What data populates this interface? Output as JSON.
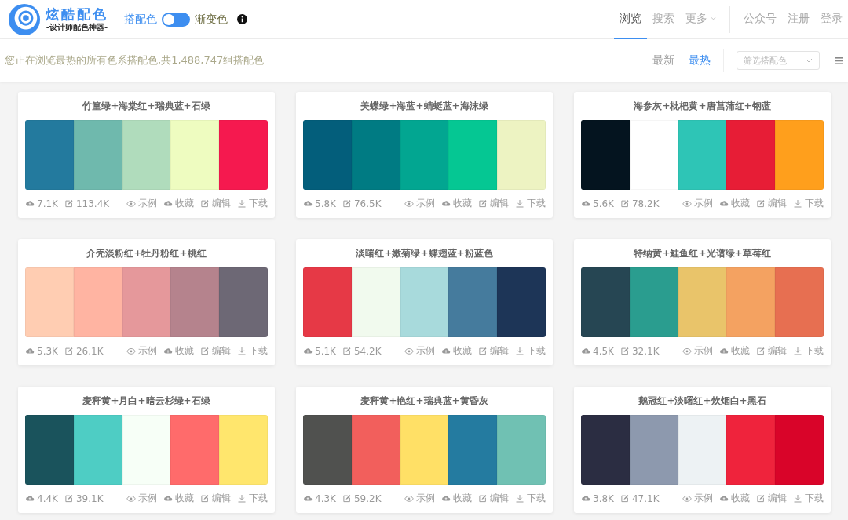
{
  "logo": {
    "title": "炫酷配色",
    "subtitle": "-设计师配色神器-"
  },
  "mode_switch": {
    "left_label": "搭配色",
    "right_label": "渐变色",
    "on": false
  },
  "nav": [
    {
      "label": "浏览",
      "selected": true
    },
    {
      "label": "搜索",
      "selected": false
    },
    {
      "label": "更多",
      "selected": false,
      "kind": "dropdown"
    },
    {
      "label": "公众号",
      "selected": false,
      "kind": "divided"
    },
    {
      "label": "注册",
      "selected": false
    },
    {
      "label": "登录",
      "selected": false
    }
  ],
  "summary": "您正在浏览最热的所有色系搭配色,共1,488,747组搭配色",
  "sort": [
    {
      "label": "最新",
      "selected": false
    },
    {
      "label": "最热",
      "selected": true
    }
  ],
  "filter": {
    "placeholder": "筛选搭配色"
  },
  "cards": [
    {
      "title": "竹篁绿+海棠红+瑞典蓝+石绿",
      "swatches": [
        {
          "color": "#237a9e"
        },
        {
          "color": "#6fb9ad"
        },
        {
          "color": "#b0dcbc"
        },
        {
          "color": "#eefcc0"
        },
        {
          "color": "#f5194f"
        }
      ],
      "stats": [
        {
          "kind": "cloud",
          "value": "7.1K"
        },
        {
          "kind": "edit",
          "value": "113.4K"
        }
      ],
      "actions": [
        {
          "kind": "eye",
          "label": "示例"
        },
        {
          "kind": "cloud",
          "label": "收藏"
        },
        {
          "kind": "edit",
          "label": "编辑"
        },
        {
          "kind": "download",
          "label": "下载"
        }
      ]
    },
    {
      "title": "美蝶绿+海蓝+蜻蜓蓝+海沫绿",
      "swatches": [
        {
          "color": "#035e7b"
        },
        {
          "color": "#007b83"
        },
        {
          "color": "#02a691"
        },
        {
          "color": "#05c793"
        },
        {
          "color": "#edf3c2"
        }
      ],
      "stats": [
        {
          "kind": "cloud",
          "value": "5.8K"
        },
        {
          "kind": "edit",
          "value": "76.5K"
        }
      ],
      "actions": [
        {
          "kind": "eye",
          "label": "示例"
        },
        {
          "kind": "cloud",
          "label": "收藏"
        },
        {
          "kind": "edit",
          "label": "编辑"
        },
        {
          "kind": "download",
          "label": "下载"
        }
      ]
    },
    {
      "title": "海参灰+枇杷黄+唐菖蒲红+钢蓝",
      "swatches": [
        {
          "color": "#04141f"
        },
        {
          "color": "#ffffff"
        },
        {
          "color": "#2ec5b6"
        },
        {
          "color": "#e71d36"
        },
        {
          "color": "#ff9f1c"
        }
      ],
      "stats": [
        {
          "kind": "cloud",
          "value": "5.6K"
        },
        {
          "kind": "edit",
          "value": "78.2K"
        }
      ],
      "actions": [
        {
          "kind": "eye",
          "label": "示例"
        },
        {
          "kind": "cloud",
          "label": "收藏"
        },
        {
          "kind": "edit",
          "label": "编辑"
        },
        {
          "kind": "download",
          "label": "下载"
        }
      ]
    },
    {
      "title": "介壳淡粉红+牡丹粉红+桃红",
      "swatches": [
        {
          "color": "#ffcdb2"
        },
        {
          "color": "#ffb4a2"
        },
        {
          "color": "#e5989b"
        },
        {
          "color": "#b5838d"
        },
        {
          "color": "#6d6875"
        }
      ],
      "stats": [
        {
          "kind": "cloud",
          "value": "5.3K"
        },
        {
          "kind": "edit",
          "value": "26.1K"
        }
      ],
      "actions": [
        {
          "kind": "eye",
          "label": "示例"
        },
        {
          "kind": "cloud",
          "label": "收藏"
        },
        {
          "kind": "edit",
          "label": "编辑"
        },
        {
          "kind": "download",
          "label": "下载"
        }
      ]
    },
    {
      "title": "淡曙红+嫩菊绿+蝶翅蓝+粉蓝色",
      "swatches": [
        {
          "color": "#e63946"
        },
        {
          "color": "#f1faee"
        },
        {
          "color": "#a8dadc"
        },
        {
          "color": "#457b9d"
        },
        {
          "color": "#1d3557"
        }
      ],
      "stats": [
        {
          "kind": "cloud",
          "value": "5.1K"
        },
        {
          "kind": "edit",
          "value": "54.2K"
        }
      ],
      "actions": [
        {
          "kind": "eye",
          "label": "示例"
        },
        {
          "kind": "cloud",
          "label": "收藏"
        },
        {
          "kind": "edit",
          "label": "编辑"
        },
        {
          "kind": "download",
          "label": "下载"
        }
      ]
    },
    {
      "title": "特纳黄+鲑鱼红+光谱绿+草莓红",
      "swatches": [
        {
          "color": "#264653"
        },
        {
          "color": "#2a9d8f"
        },
        {
          "color": "#e9c46a"
        },
        {
          "color": "#f4a261"
        },
        {
          "color": "#e76f51"
        }
      ],
      "stats": [
        {
          "kind": "cloud",
          "value": "4.5K"
        },
        {
          "kind": "edit",
          "value": "32.1K"
        }
      ],
      "actions": [
        {
          "kind": "eye",
          "label": "示例"
        },
        {
          "kind": "cloud",
          "label": "收藏"
        },
        {
          "kind": "edit",
          "label": "编辑"
        },
        {
          "kind": "download",
          "label": "下载"
        }
      ]
    },
    {
      "title": "麦秆黄+月白+暗云杉绿+石绿",
      "swatches": [
        {
          "color": "#1a535c"
        },
        {
          "color": "#4ecdc4"
        },
        {
          "color": "#f7fff7"
        },
        {
          "color": "#ff6b6b"
        },
        {
          "color": "#ffe66d"
        }
      ],
      "stats": [
        {
          "kind": "cloud",
          "value": "4.4K"
        },
        {
          "kind": "edit",
          "value": "39.1K"
        }
      ],
      "actions": [
        {
          "kind": "eye",
          "label": "示例"
        },
        {
          "kind": "cloud",
          "label": "收藏"
        },
        {
          "kind": "edit",
          "label": "编辑"
        },
        {
          "kind": "download",
          "label": "下载"
        }
      ]
    },
    {
      "title": "麦秆黄+艳红+瑞典蓝+黄昏灰",
      "swatches": [
        {
          "color": "#50514f"
        },
        {
          "color": "#f25f5c"
        },
        {
          "color": "#ffe066"
        },
        {
          "color": "#247ba0"
        },
        {
          "color": "#70c1b3"
        }
      ],
      "stats": [
        {
          "kind": "cloud",
          "value": "4.3K"
        },
        {
          "kind": "edit",
          "value": "59.2K"
        }
      ],
      "actions": [
        {
          "kind": "eye",
          "label": "示例"
        },
        {
          "kind": "cloud",
          "label": "收藏"
        },
        {
          "kind": "edit",
          "label": "编辑"
        },
        {
          "kind": "download",
          "label": "下载"
        }
      ]
    },
    {
      "title": "鹅冠红+淡曙红+炊烟白+黑石",
      "swatches": [
        {
          "color": "#2b2d42"
        },
        {
          "color": "#8d99ae"
        },
        {
          "color": "#edf2f4"
        },
        {
          "color": "#ef233c"
        },
        {
          "color": "#d90429"
        }
      ],
      "stats": [
        {
          "kind": "cloud",
          "value": "3.8K"
        },
        {
          "kind": "edit",
          "value": "47.1K"
        }
      ],
      "actions": [
        {
          "kind": "eye",
          "label": "示例"
        },
        {
          "kind": "cloud",
          "label": "收藏"
        },
        {
          "kind": "edit",
          "label": "编辑"
        },
        {
          "kind": "download",
          "label": "下载"
        }
      ]
    }
  ]
}
